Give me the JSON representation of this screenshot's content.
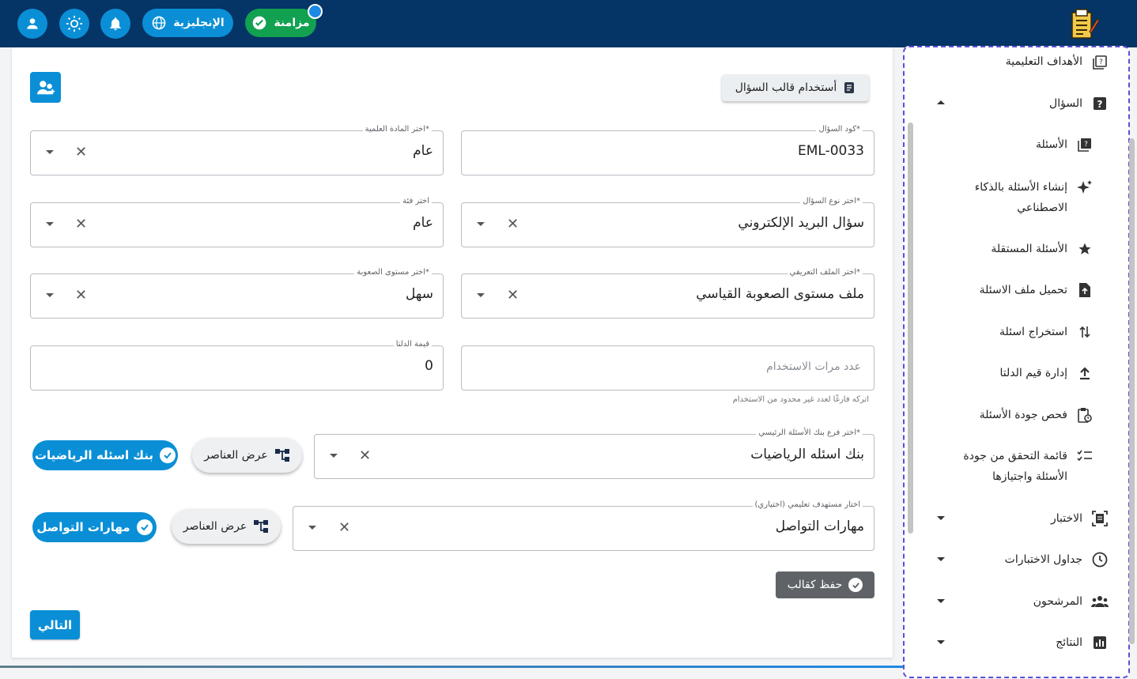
{
  "header": {
    "language_label": "الإنجليزية",
    "sync_label": "مزامنة",
    "icons": [
      "user-icon",
      "brightness-icon",
      "bell-icon",
      "globe-icon",
      "check-circle-icon",
      "exam-logo-icon"
    ]
  },
  "toolbar": {
    "use_template_label": "أستخدام قالب السؤال"
  },
  "form": {
    "question_code": {
      "label": "كود السؤال*",
      "value": "EML-0033"
    },
    "subject": {
      "label": "اختر المادة العلمية*",
      "value": "عام"
    },
    "question_type": {
      "label": "اختر نوع السؤال*",
      "value": "سؤال البريد الإلكتروني"
    },
    "category": {
      "label": "اختر فئة",
      "value": "عام"
    },
    "profile": {
      "label": "اختر الملف التعريفي*",
      "value": "ملف مستوى الصعوبة القياسي"
    },
    "difficulty": {
      "label": "اختر مستوى الصعوبة*",
      "value": "سهل"
    },
    "usage_count": {
      "placeholder": "عدد مرات الاستخدام",
      "hint": "اتركه فارغًا لعدد غير محدود من الاستخدام"
    },
    "delta": {
      "label": "قيمة الدلتا",
      "value": "0"
    },
    "bank_branch": {
      "label": "اختر فرع بنك الأسئلة الرئيسي*",
      "value": "بنك اسئله الرياضيات",
      "chip": "بنك اسئله الرياضيات",
      "show_items": "عرض العناصر"
    },
    "learning_target": {
      "label": "اختار مستهدف تعليمي (اختياري)",
      "value": "مهارات التواصل",
      "chip": "مهارات التواصل",
      "show_items": "عرض العناصر"
    },
    "save_template_label": "حفظ كقالب",
    "next_label": "التالي"
  },
  "sidebar": {
    "items": [
      {
        "label": "الأهداف التعليمية",
        "icon": "book-question-icon"
      },
      {
        "label": "السؤال",
        "icon": "question-box-icon",
        "expanded": true
      },
      {
        "label": "الأسئلة",
        "icon": "book-question-icon",
        "sub": true
      },
      {
        "label": "إنشاء الأسئلة بالذكاء",
        "label2": "الاصطناعي",
        "icon": "sparkle-icon",
        "sub": true
      },
      {
        "label": "الأسئلة المستقلة",
        "icon": "star-icon",
        "sub": true
      },
      {
        "label": "تحميل ملف الاسئلة",
        "icon": "file-upload-icon",
        "sub": true
      },
      {
        "label": "استخراج اسئلة",
        "icon": "swap-vertical-icon",
        "sub": true
      },
      {
        "label": "إدارة قيم الدلتا",
        "icon": "upload-icon",
        "sub": true
      },
      {
        "label": "فحص جودة الأسئلة",
        "icon": "clipboard-clock-icon",
        "sub": true
      },
      {
        "label": "قائمة التحقق من جودة",
        "label2": "الأسئلة واجتيازها",
        "icon": "checklist-icon",
        "sub": true
      },
      {
        "label": "الاختبار",
        "icon": "exam-frame-icon"
      },
      {
        "label": "جداول الاختبارات",
        "icon": "clock-icon"
      },
      {
        "label": "المرشحون",
        "icon": "people-icon"
      },
      {
        "label": "النتائج",
        "icon": "bar-chart-icon"
      }
    ]
  }
}
